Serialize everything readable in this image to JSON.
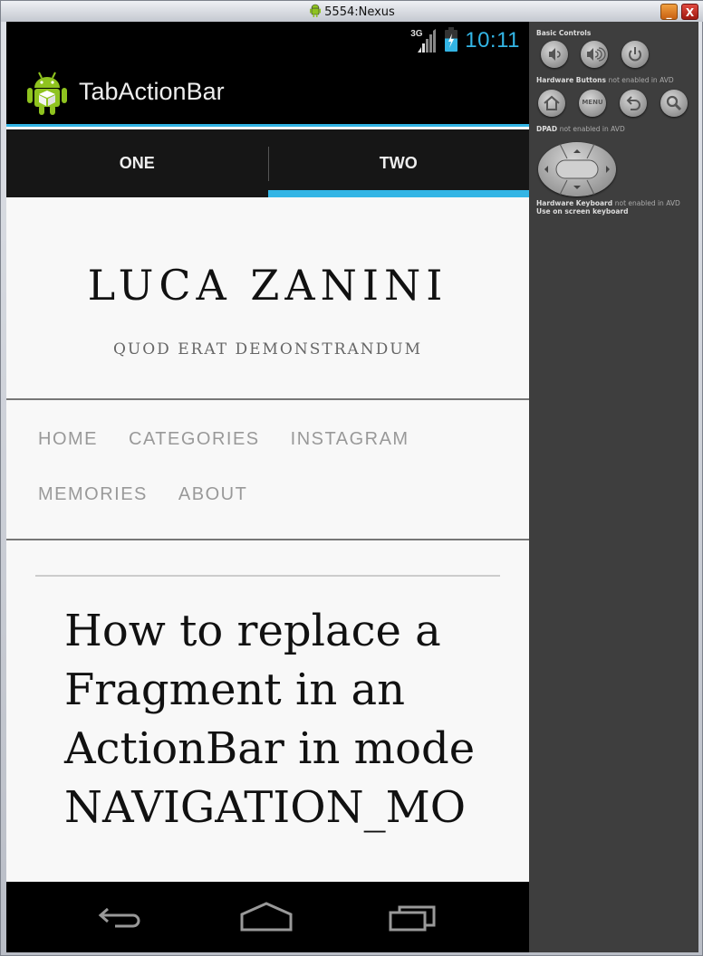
{
  "window": {
    "title": "5554:Nexus",
    "minimize_label": "_",
    "close_label": "X"
  },
  "statusbar": {
    "network_label": "3G",
    "time": "10:11"
  },
  "actionbar": {
    "app_title": "TabActionBar"
  },
  "tabs": [
    {
      "label": "ONE",
      "selected": false
    },
    {
      "label": "TWO",
      "selected": true
    }
  ],
  "webpage": {
    "site_title": "LUCA ZANINI",
    "tagline": "QUOD ERAT DEMONSTRANDUM",
    "menu_rows": [
      [
        "HOME",
        "CATEGORIES",
        "INSTAGRAM"
      ],
      [
        "MEMORIES",
        "ABOUT"
      ]
    ],
    "post_title": "How to replace a Fragment in an ActionBar in mode NAVIGATION_MO"
  },
  "emulator_panel": {
    "basic_controls_label": "Basic Controls",
    "hardware_buttons_label": "Hardware Buttons",
    "hardware_buttons_note": "not enabled in AVD",
    "menu_button_label": "MENU",
    "dpad_label": "DPAD",
    "dpad_note": "not enabled in AVD",
    "keyboard_label": "Hardware Keyboard",
    "keyboard_note": "not enabled in AVD",
    "keyboard_hint": "Use on screen keyboard"
  },
  "colors": {
    "accent": "#33b5e5",
    "actionbar_bg": "#000000",
    "tabbar_bg": "#161616",
    "panel_bg": "#3e3e3e"
  }
}
